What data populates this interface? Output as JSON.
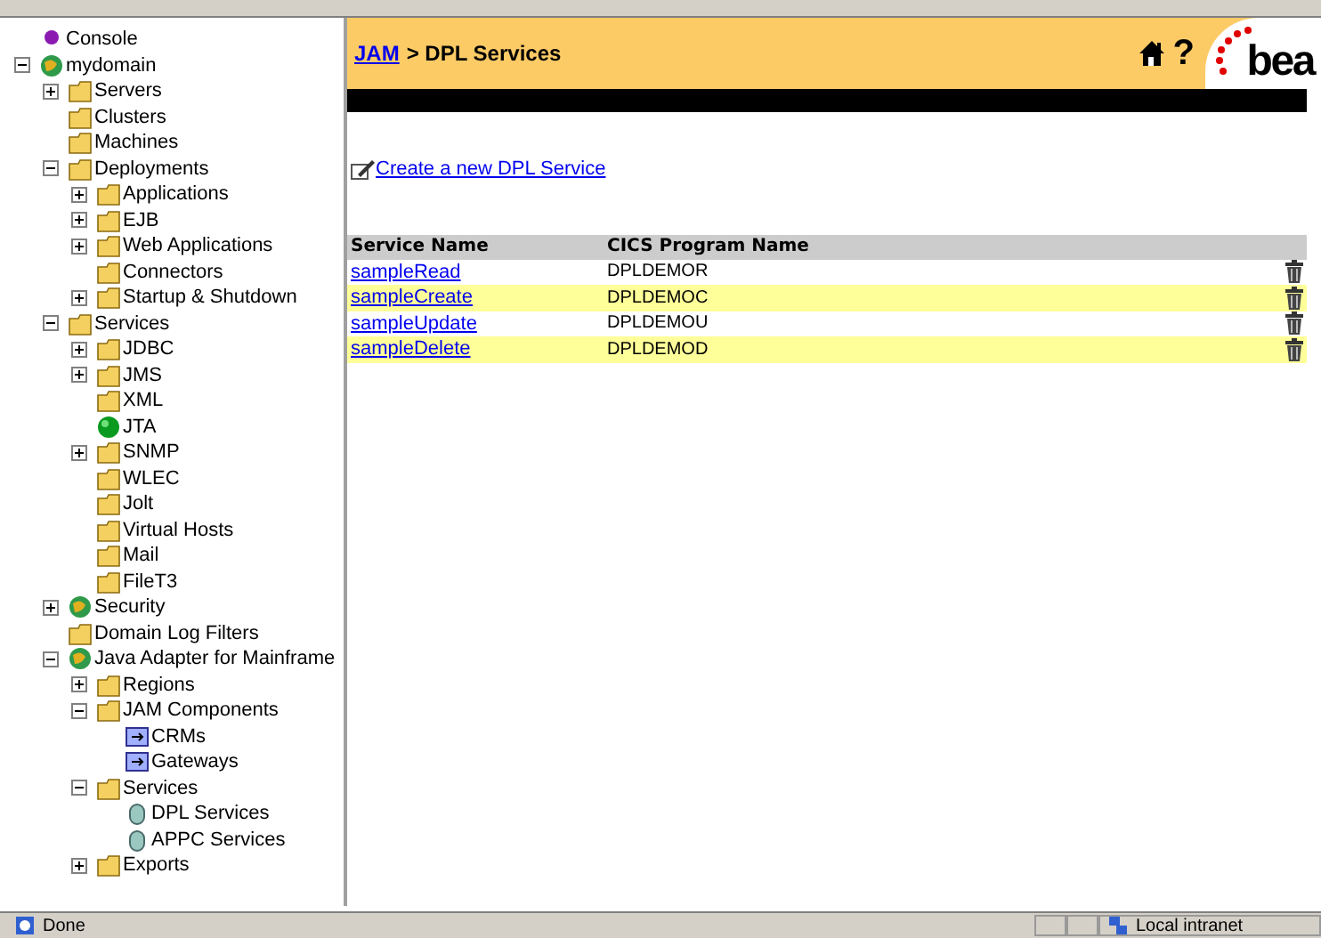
{
  "tree": [
    {
      "label": "Console",
      "kind": "dot"
    },
    {
      "label": "mydomain",
      "kind": "globe",
      "expanded": true,
      "children": [
        {
          "label": "Servers",
          "kind": "folder",
          "expanded": false
        },
        {
          "label": "Clusters",
          "kind": "folder"
        },
        {
          "label": "Machines",
          "kind": "folder"
        },
        {
          "label": "Deployments",
          "kind": "folder",
          "expanded": true,
          "children": [
            {
              "label": "Applications",
              "kind": "folder",
              "expanded": false
            },
            {
              "label": "EJB",
              "kind": "folder",
              "expanded": false
            },
            {
              "label": "Web Applications",
              "kind": "folder",
              "expanded": false
            },
            {
              "label": "Connectors",
              "kind": "folder"
            },
            {
              "label": "Startup & Shutdown",
              "kind": "folder",
              "expanded": false
            }
          ]
        },
        {
          "label": "Services",
          "kind": "folder",
          "expanded": true,
          "children": [
            {
              "label": "JDBC",
              "kind": "folder",
              "expanded": false
            },
            {
              "label": "JMS",
              "kind": "folder",
              "expanded": false
            },
            {
              "label": "XML",
              "kind": "folder"
            },
            {
              "label": "JTA",
              "kind": "ball"
            },
            {
              "label": "SNMP",
              "kind": "folder",
              "expanded": false
            },
            {
              "label": "WLEC",
              "kind": "folder"
            },
            {
              "label": "Jolt",
              "kind": "folder"
            },
            {
              "label": "Virtual Hosts",
              "kind": "folder"
            },
            {
              "label": "Mail",
              "kind": "folder"
            },
            {
              "label": "FileT3",
              "kind": "folder"
            }
          ]
        },
        {
          "label": "Security",
          "kind": "globe",
          "expanded": false
        },
        {
          "label": "Domain Log Filters",
          "kind": "folder"
        },
        {
          "label": "Java Adapter for Mainframe",
          "kind": "globe",
          "expanded": true,
          "children": [
            {
              "label": "Regions",
              "kind": "folder",
              "expanded": false
            },
            {
              "label": "JAM Components",
              "kind": "folder",
              "expanded": true,
              "children": [
                {
                  "label": "CRMs",
                  "kind": "box"
                },
                {
                  "label": "Gateways",
                  "kind": "box"
                }
              ]
            },
            {
              "label": "Services",
              "kind": "folder",
              "expanded": true,
              "children": [
                {
                  "label": "DPL Services",
                  "kind": "cylinder"
                },
                {
                  "label": "APPC Services",
                  "kind": "cylinder"
                }
              ]
            },
            {
              "label": "Exports",
              "kind": "folder",
              "expanded": false
            }
          ]
        }
      ]
    }
  ],
  "header": {
    "breadcrumb_link": "JAM",
    "breadcrumb_rest": "> DPL Services",
    "help": "?",
    "logo": "bea"
  },
  "create_link": "Create a new DPL Service",
  "table": {
    "columns": [
      "Service Name",
      "CICS Program Name"
    ],
    "rows": [
      {
        "service": "sampleRead",
        "program": "DPLDEMOR"
      },
      {
        "service": "sampleCreate",
        "program": "DPLDEMOC"
      },
      {
        "service": "sampleUpdate",
        "program": "DPLDEMOU"
      },
      {
        "service": "sampleDelete",
        "program": "DPLDEMOD"
      }
    ]
  },
  "status_bar": {
    "text": "Done",
    "zone": "Local intranet"
  }
}
